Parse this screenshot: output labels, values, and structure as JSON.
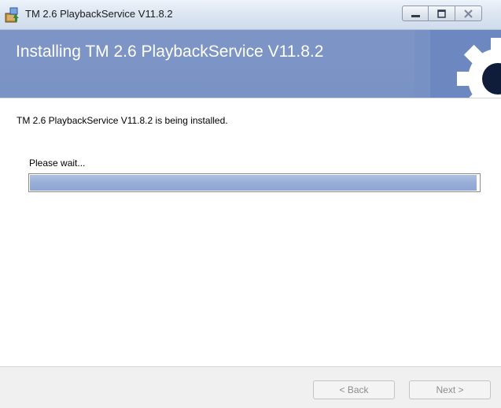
{
  "window": {
    "title": "TM 2.6 PlaybackService V11.8.2",
    "icon": "installer-icon",
    "controls": [
      "minimize-icon",
      "maximize-icon",
      "close-icon"
    ]
  },
  "banner": {
    "title": "Installing TM 2.6 PlaybackService V11.8.2",
    "art_icon": "gear-icon",
    "color": "#7d95c6"
  },
  "content": {
    "status_text": "TM 2.6 PlaybackService V11.8.2 is being installed.",
    "wait_text": "Please wait...",
    "progress_fraction": 0.995
  },
  "buttons": {
    "back_label": "< Back",
    "next_label": "Next >"
  }
}
